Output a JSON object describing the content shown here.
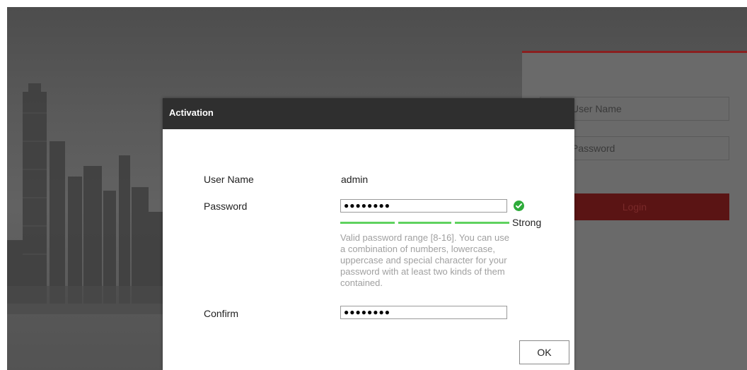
{
  "login": {
    "username_placeholder": "User Name",
    "password_placeholder": "Password",
    "login_label": "Login"
  },
  "dialog": {
    "title": "Activation",
    "username_label": "User Name",
    "username_value": "admin",
    "password_label": "Password",
    "password_mask": "●●●●●●●●",
    "strength_text": "Strong",
    "hint": "Valid password range [8-16]. You can use a combination of numbers, lowercase, uppercase and special character for your password with at least two kinds of them contained.",
    "confirm_label": "Confirm",
    "confirm_mask": "●●●●●●●●",
    "ok_label": "OK"
  },
  "icons": {
    "valid": "check-circle-icon"
  },
  "colors": {
    "accent_red": "#8a1f1f",
    "login_button": "#5a1414",
    "strength_green": "#5fd25f",
    "valid_green": "#2eab3a",
    "dialog_header": "#2f2f2f"
  }
}
